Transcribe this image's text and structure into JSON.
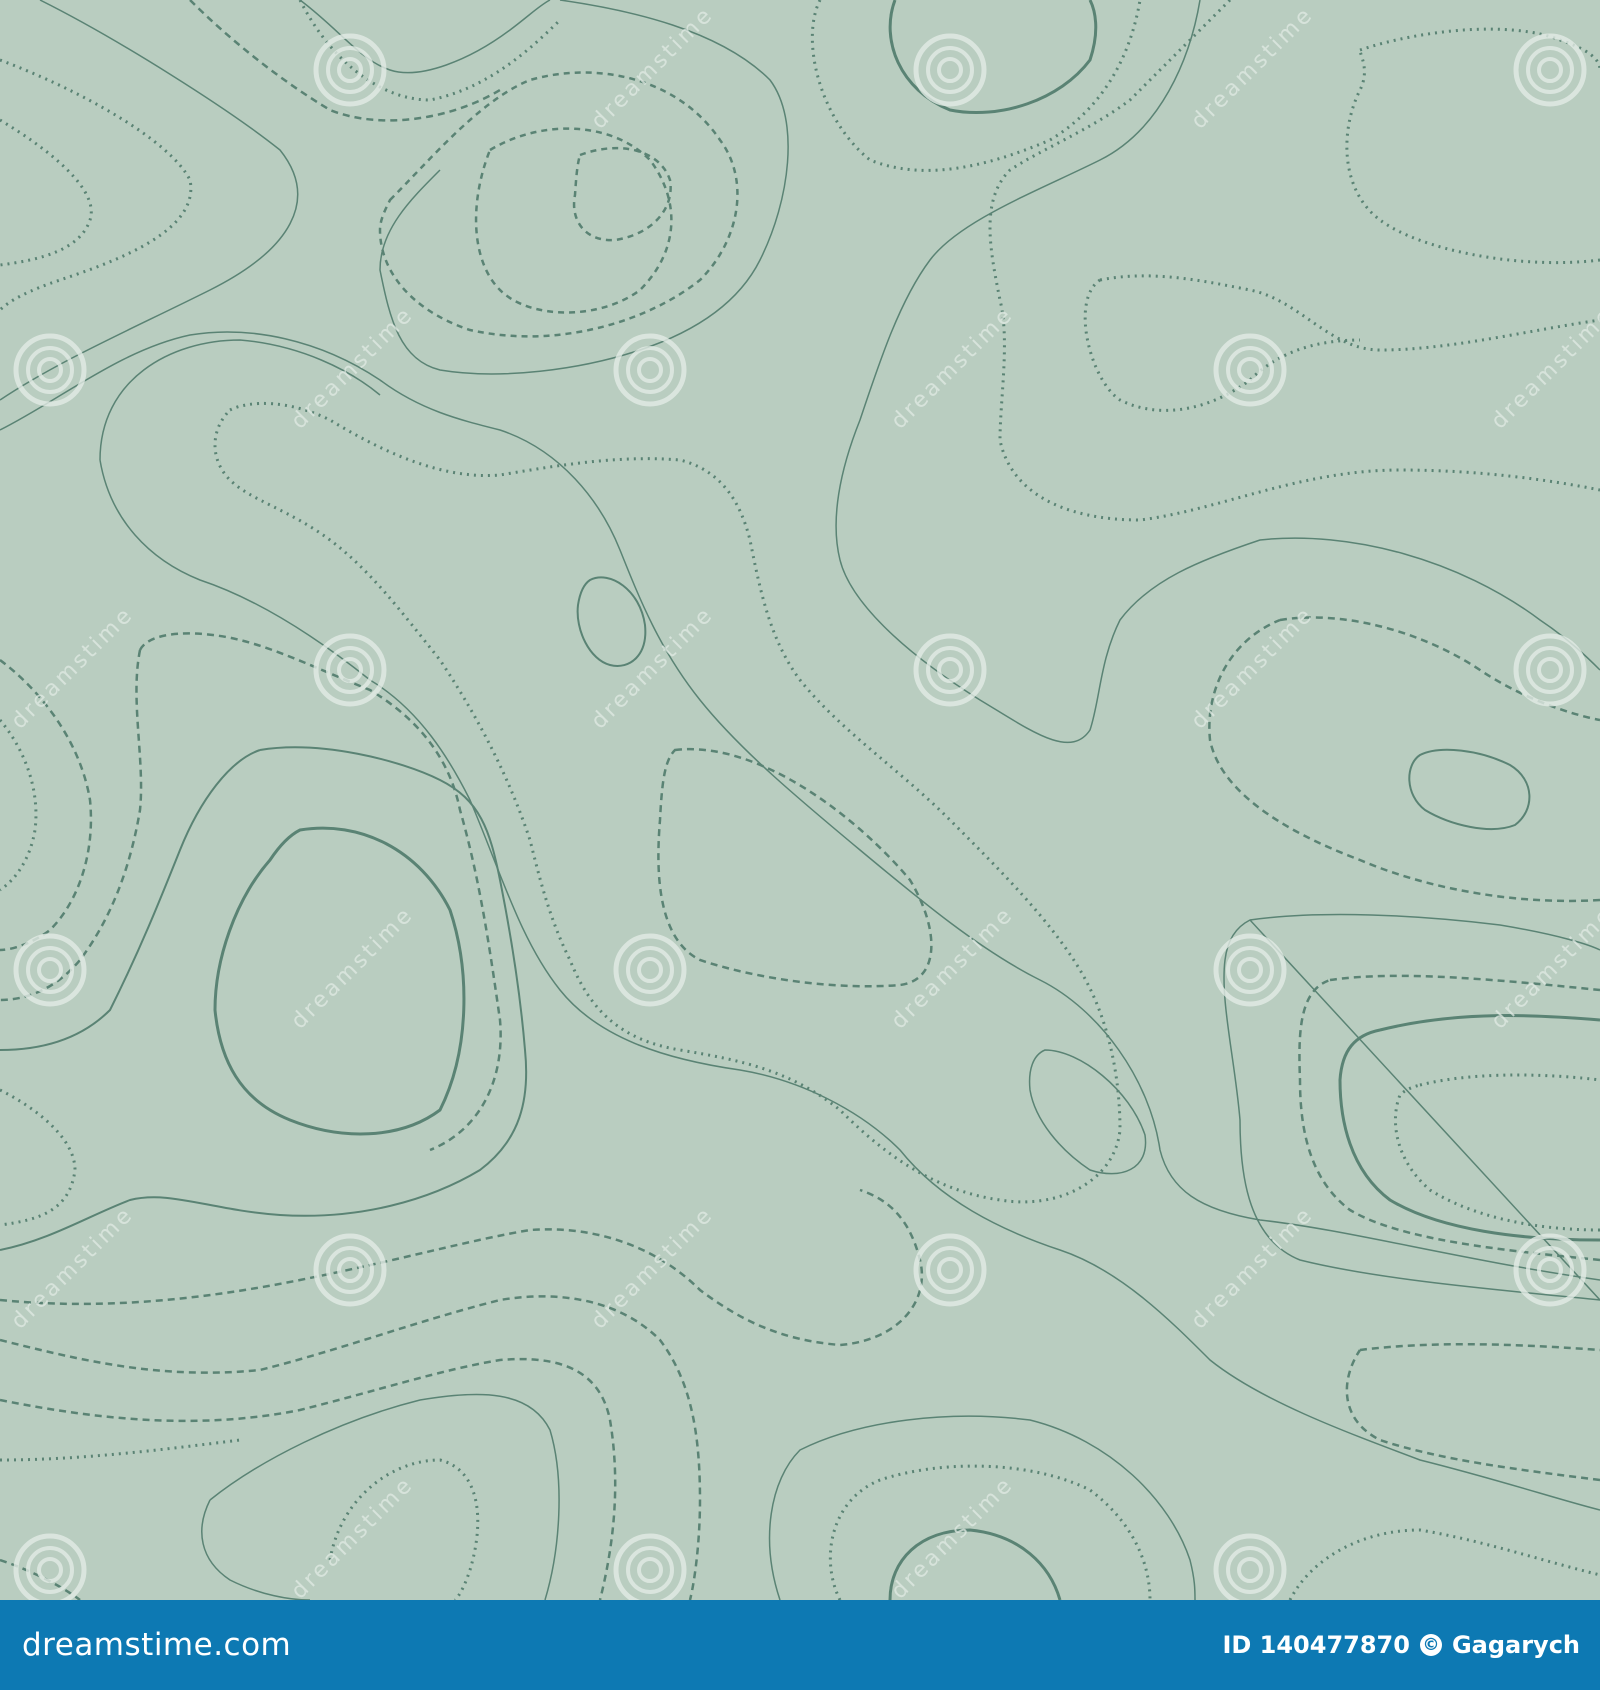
{
  "colors": {
    "background": "#b9cdc0",
    "contour": "#5a8374",
    "footer_bar": "#0d79b3",
    "watermark": "#e2ebe5"
  },
  "watermark": {
    "text": "dreamstime",
    "icon": "swirl-logo-icon"
  },
  "footer": {
    "brand": "dreamstime.com",
    "image_id": "ID 140477870",
    "copyright_icon": "copyright-icon",
    "copyright_symbol": "©",
    "author": "Gagarych"
  }
}
